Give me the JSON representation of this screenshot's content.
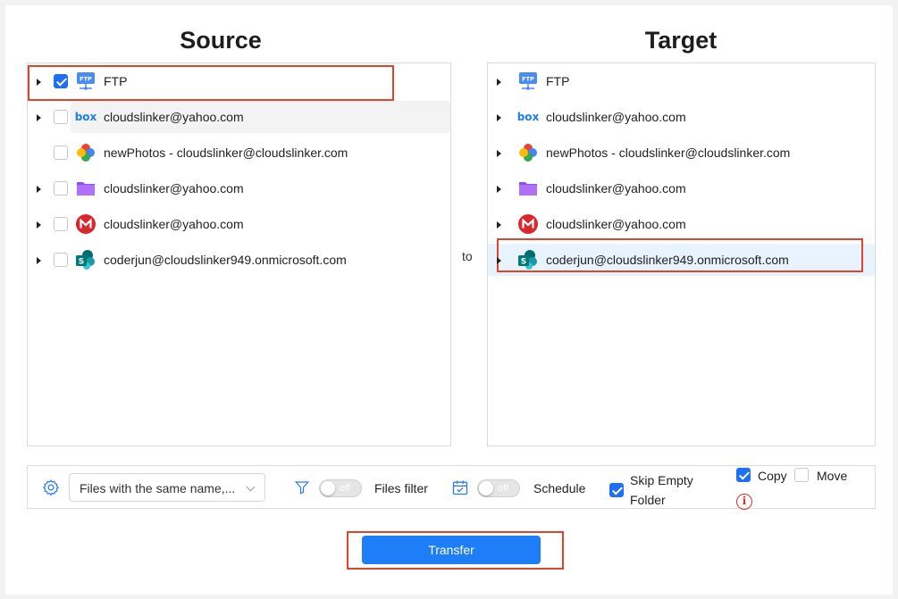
{
  "headings": {
    "source": "Source",
    "target": "Target"
  },
  "connector": "to",
  "source_items": [
    {
      "icon": "ftp-icon",
      "label": "FTP",
      "checked": true,
      "expandable": true
    },
    {
      "icon": "box-icon",
      "label": "cloudslinker@yahoo.com",
      "checked": false,
      "expandable": true
    },
    {
      "icon": "google-photos-icon",
      "label": "newPhotos - cloudslinker@cloudslinker.com",
      "checked": false,
      "expandable": false
    },
    {
      "icon": "purple-folder-icon",
      "label": "cloudslinker@yahoo.com",
      "checked": false,
      "expandable": true
    },
    {
      "icon": "mega-icon",
      "label": "cloudslinker@yahoo.com",
      "checked": false,
      "expandable": true
    },
    {
      "icon": "sharepoint-icon",
      "label": "coderjun@cloudslinker949.onmicrosoft.com",
      "checked": false,
      "expandable": true
    }
  ],
  "target_items": [
    {
      "icon": "ftp-icon",
      "label": "FTP"
    },
    {
      "icon": "box-icon",
      "label": "cloudslinker@yahoo.com"
    },
    {
      "icon": "google-photos-icon",
      "label": "newPhotos - cloudslinker@cloudslinker.com"
    },
    {
      "icon": "purple-folder-icon",
      "label": "cloudslinker@yahoo.com"
    },
    {
      "icon": "mega-icon",
      "label": "cloudslinker@yahoo.com"
    },
    {
      "icon": "sharepoint-icon",
      "label": "coderjun@cloudslinker949.onmicrosoft.com",
      "selected": true
    }
  ],
  "options": {
    "conflict_select": "Files with the same name,...",
    "files_filter_toggle": "off",
    "files_filter_label": "Files filter",
    "schedule_toggle": "off",
    "schedule_label": "Schedule",
    "skip_empty_label_line1": "Skip Empty",
    "skip_empty_label_line2": "Folder",
    "skip_empty_checked": true,
    "copy_label": "Copy",
    "copy_checked": true,
    "move_label": "Move",
    "move_checked": false,
    "info_glyph": "i"
  },
  "transfer_button": "Transfer",
  "colors": {
    "accent": "#1e7ef7",
    "highlight": "#e0442a"
  }
}
